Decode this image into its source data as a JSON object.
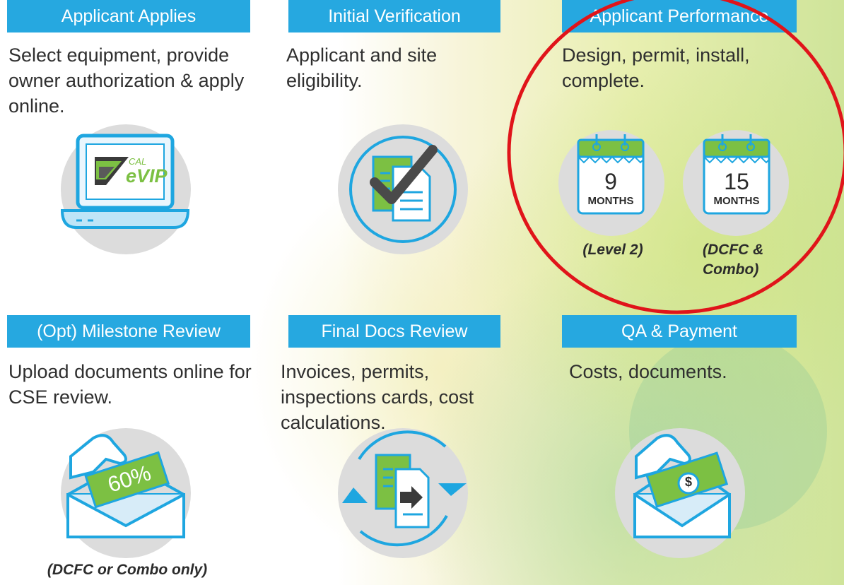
{
  "steps": [
    {
      "title": "Applicant Applies",
      "description": "Select equipment, provide owner authorization & apply online."
    },
    {
      "title": "Initial Verification",
      "description": "Applicant and site eligibility."
    },
    {
      "title": "Applicant Performance",
      "description": "Design, permit, install, complete."
    },
    {
      "title": "(Opt) Milestone Review",
      "description": "Upload documents online for CSE review."
    },
    {
      "title": "Final Docs Review",
      "description": "Invoices, permits, inspections cards, cost calculations."
    },
    {
      "title": "QA & Payment",
      "description": "Costs, documents."
    }
  ],
  "laptop": {
    "logo_small": "CAL",
    "logo_big": "eVIP"
  },
  "calendars": [
    {
      "number": "9",
      "unit": "MONTHS",
      "caption": "(Level 2)"
    },
    {
      "number": "15",
      "unit": "MONTHS",
      "caption": "(DCFC & Combo)"
    }
  ],
  "milestone": {
    "percent": "60%",
    "caption": "(DCFC or Combo only)"
  },
  "payment": {
    "symbol": "$"
  },
  "colors": {
    "header_blue": "#26a8e0",
    "icon_blue": "#1ea6e0",
    "icon_green": "#7cc043",
    "highlight_red": "#e0141a"
  },
  "icons": [
    "laptop-icon",
    "document-check-icon",
    "calendar-icon",
    "envelope-money-icon",
    "document-cycle-icon",
    "envelope-dollar-icon"
  ]
}
